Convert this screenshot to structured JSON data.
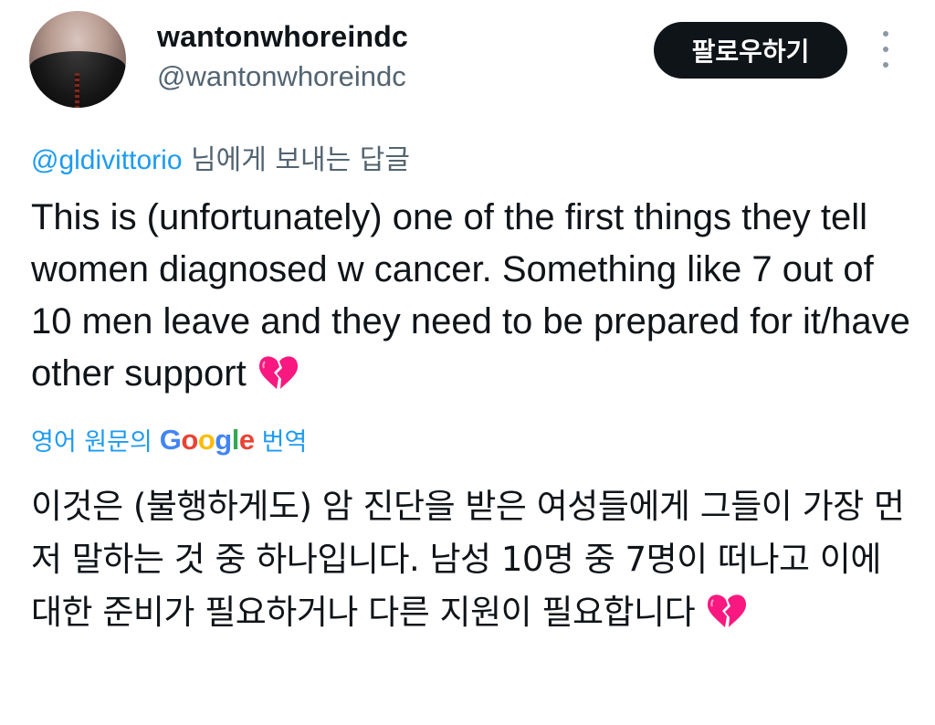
{
  "author": {
    "display_name": "wantonwhoreindc",
    "handle": "@wantonwhoreindc"
  },
  "actions": {
    "follow_label": "팔로우하기",
    "more_icon": "more-vertical-icon"
  },
  "reply": {
    "mention": "@gldivittorio",
    "suffix": " 님에게 보내는 답글"
  },
  "tweet": {
    "text": "This is (unfortunately) one of the first things they tell women diagnosed w cancer. Something like 7 out of 10 men leave and they need to be prepared for it/have other support ",
    "emoji": "broken-heart-icon"
  },
  "translation": {
    "prefix": "영어 원문의",
    "provider": "Google",
    "suffix": "번역",
    "text": "이것은 (불행하게도) 암 진단을 받은 여성들에게 그들이 가장 먼저 말하는 것 중 하나입니다. 남성 10명 중 7명이 떠나고 이에 대한 준비가 필요하거나 다른 지원이 필요합니다 "
  },
  "colors": {
    "link": "#1d9bf0",
    "secondary_text": "#536471",
    "primary_text": "#0f1419",
    "heart": "#f91880"
  }
}
